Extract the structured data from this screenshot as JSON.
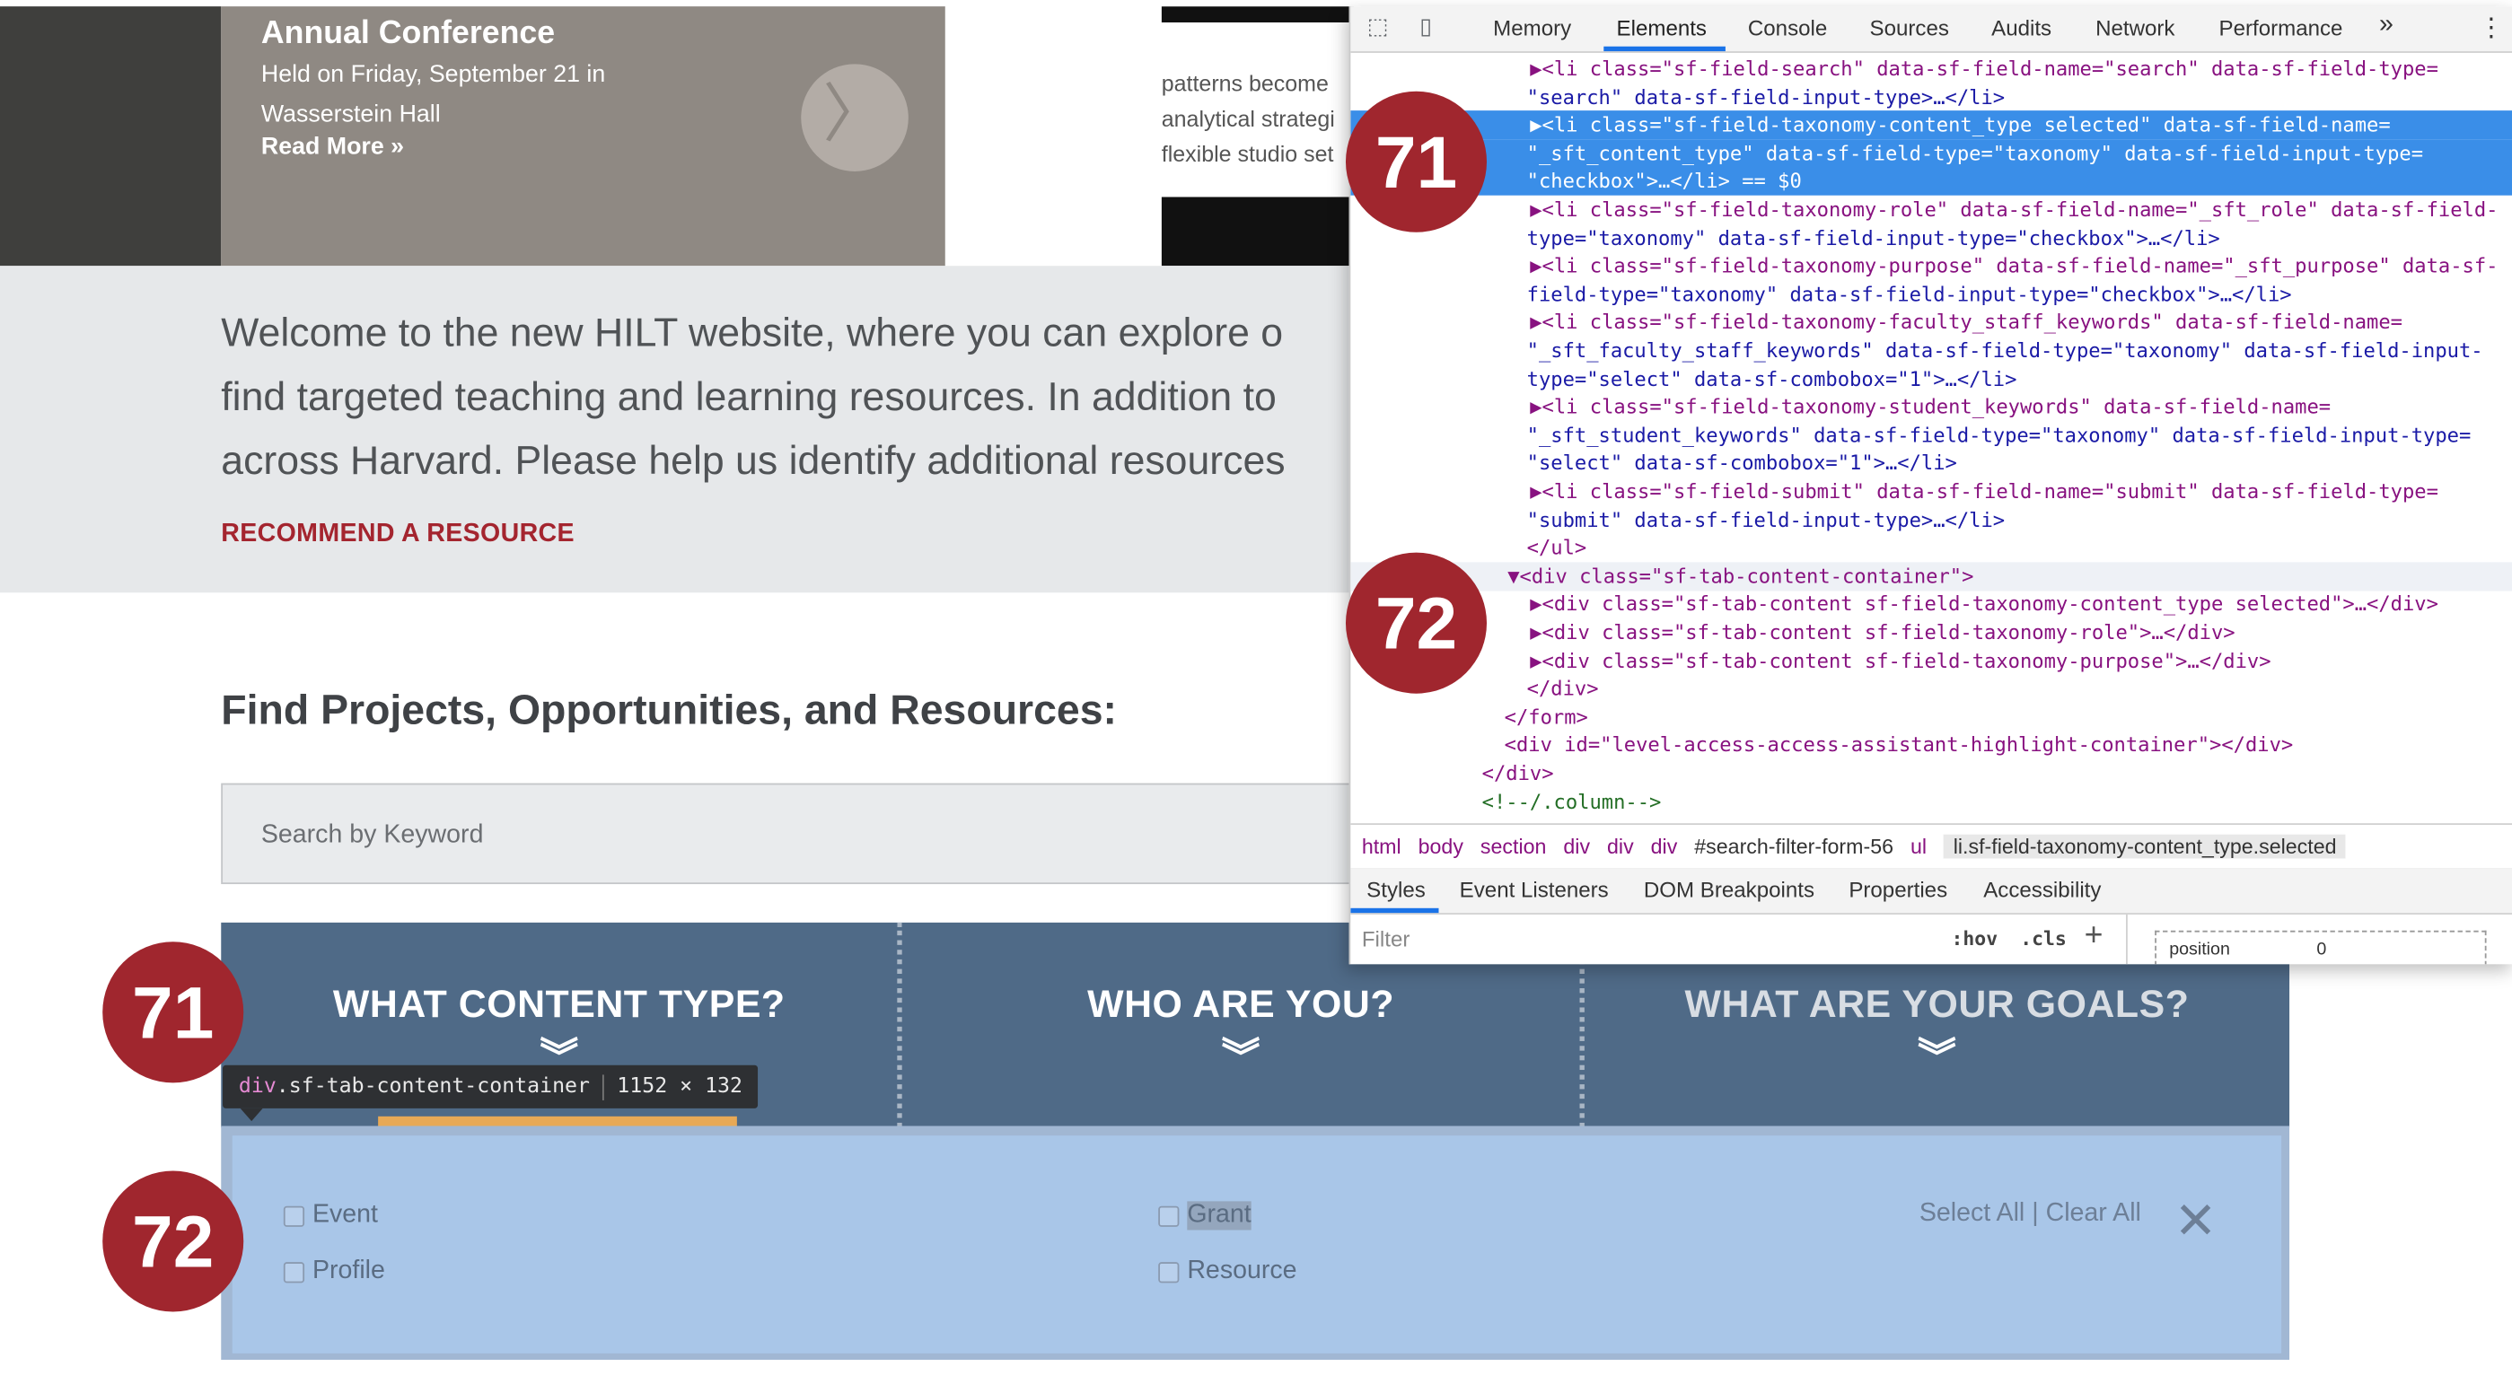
{
  "hero": {
    "title": "Annual Conference",
    "desc": "Held on Friday, September 21 in Wasserstein Hall",
    "read_more": "Read More »",
    "next_arrow": "〉"
  },
  "side_snippet": {
    "lines": [
      "patterns become",
      "analytical strategi",
      "flexible studio set"
    ]
  },
  "intro": {
    "lines": [
      "Welcome to the new HILT website, where you can explore o",
      "find targeted teaching and learning resources. In addition to",
      "across Harvard. Please help us identify additional resources"
    ],
    "link": "RECOMMEND A RESOURCE"
  },
  "find_heading": "Find Projects, Opportunities, and Resources:",
  "search": {
    "placeholder": "Search by Keyword"
  },
  "tabs": [
    {
      "label": "WHAT CONTENT TYPE?",
      "chevron": "︾"
    },
    {
      "label": "WHO ARE YOU?",
      "chevron": "︾"
    },
    {
      "label": "WHAT ARE YOUR GOALS?",
      "chevron": "︾"
    }
  ],
  "tooltip": {
    "tag": "div",
    "cls": ".sf-tab-content-container",
    "size": "1152 × 132"
  },
  "options": {
    "event": "Event",
    "profile": "Profile",
    "grant": "Grant",
    "resource": "Resource",
    "select_all": "Select All",
    "separator": "|",
    "clear_all": "Clear All",
    "close": "✕"
  },
  "badges": {
    "a": "71",
    "b": "72"
  },
  "devtools": {
    "tabs": [
      "Memory",
      "Elements",
      "Console",
      "Sources",
      "Audits",
      "Network",
      "Performance"
    ],
    "more": "»",
    "menu": "⋮",
    "code_lines": [
      "▶<li class=\"sf-field-search\" data-sf-field-name=\"search\" data-sf-field-type=",
      "\"search\" data-sf-field-input-type>…</li>",
      "▶<li class=\"sf-field-taxonomy-content_type selected\" data-sf-field-name=",
      "\"_sft_content_type\" data-sf-field-type=\"taxonomy\" data-sf-field-input-type=",
      "\"checkbox\">…</li> == $0",
      "▶<li class=\"sf-field-taxonomy-role\" data-sf-field-name=\"_sft_role\" data-sf-field-",
      "type=\"taxonomy\" data-sf-field-input-type=\"checkbox\">…</li>",
      "▶<li class=\"sf-field-taxonomy-purpose\" data-sf-field-name=\"_sft_purpose\" data-sf-",
      "field-type=\"taxonomy\" data-sf-field-input-type=\"checkbox\">…</li>",
      "▶<li class=\"sf-field-taxonomy-faculty_staff_keywords\" data-sf-field-name=",
      "\"_sft_faculty_staff_keywords\" data-sf-field-type=\"taxonomy\" data-sf-field-input-",
      "type=\"select\" data-sf-combobox=\"1\">…</li>",
      "▶<li class=\"sf-field-taxonomy-student_keywords\" data-sf-field-name=",
      "\"_sft_student_keywords\" data-sf-field-type=\"taxonomy\" data-sf-field-input-type=",
      "\"select\" data-sf-combobox=\"1\">…</li>",
      "▶<li class=\"sf-field-submit\" data-sf-field-name=\"submit\" data-sf-field-type=",
      "\"submit\" data-sf-field-input-type>…</li>",
      "</ul>",
      "▼<div class=\"sf-tab-content-container\">",
      "▶<div class=\"sf-tab-content sf-field-taxonomy-content_type selected\">…</div>",
      "▶<div class=\"sf-tab-content sf-field-taxonomy-role\">…</div>",
      "▶<div class=\"sf-tab-content sf-field-taxonomy-purpose\">…</div>",
      "</div>",
      "</form>",
      "<div id=\"level-access-access-assistant-highlight-container\"></div>",
      "</div>",
      "<!--/.column-->"
    ],
    "breadcrumbs": [
      "html",
      "body",
      "section",
      "div",
      "div",
      "div",
      "#search-filter-form-56",
      "ul",
      "li.sf-field-taxonomy-content_type.selected"
    ],
    "subtabs": [
      "Styles",
      "Event Listeners",
      "DOM Breakpoints",
      "Properties",
      "Accessibility"
    ],
    "filter_placeholder": "Filter",
    "hov": ":hov",
    "cls": ".cls",
    "plus": "+",
    "box_label": "position",
    "box_value": "0"
  }
}
